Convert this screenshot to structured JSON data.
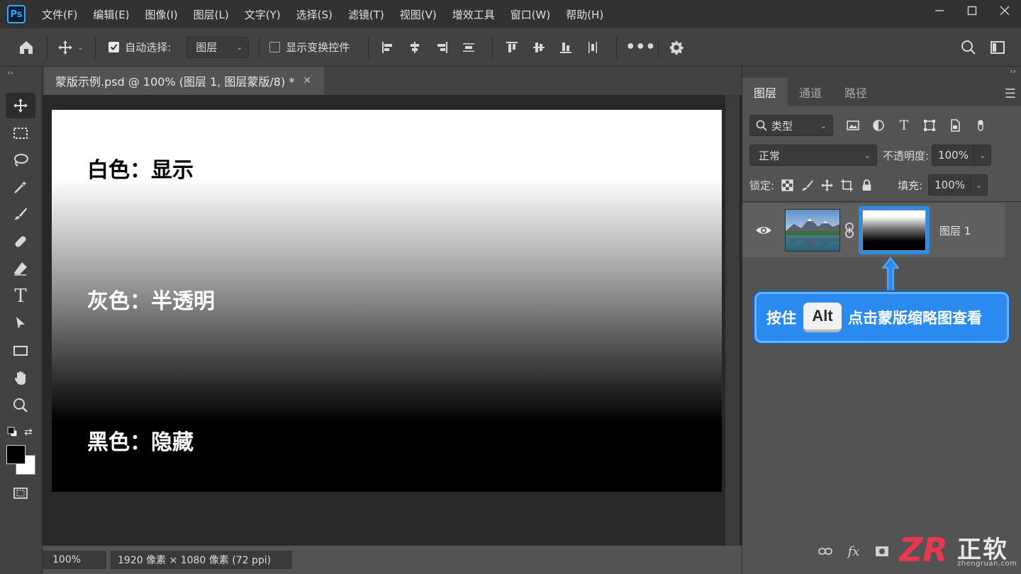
{
  "app": {
    "logo": "Ps",
    "menu": [
      "文件(F)",
      "编辑(E)",
      "图像(I)",
      "图层(L)",
      "文字(Y)",
      "选择(S)",
      "滤镜(T)",
      "视图(V)",
      "增效工具",
      "窗口(W)",
      "帮助(H)"
    ],
    "window_controls": [
      "minimize-icon",
      "maximize-icon",
      "close-icon"
    ]
  },
  "options_bar": {
    "auto_select_label": "自动选择:",
    "auto_select_checked": true,
    "auto_select_target": "图层",
    "show_transform_label": "显示变换控件",
    "show_transform_checked": false
  },
  "document": {
    "tab_title": "蒙版示例.psd @ 100% (图层 1, 图层蒙版/8) *",
    "canvas_text": {
      "white": "白色：显示",
      "gray": "灰色：半透明",
      "black": "黑色：隐藏"
    },
    "zoom": "100%",
    "info": "1920 像素 × 1080 像素 (72 ppi)"
  },
  "layers_panel": {
    "tabs": [
      "图层",
      "通道",
      "路径"
    ],
    "active_tab": "图层",
    "filter_kind": "类型",
    "blend_mode": "正常",
    "opacity_label": "不透明度:",
    "opacity_value": "100%",
    "lock_label": "锁定:",
    "fill_label": "填充:",
    "fill_value": "100%",
    "layer": {
      "name": "图层 1",
      "visible": true
    }
  },
  "callout": {
    "prefix": "按住",
    "key": "Alt",
    "suffix": "点击蒙版缩略图查看"
  },
  "watermark": {
    "logo": "ZR",
    "text": "正软",
    "url": "zhengruan.com"
  },
  "colors": {
    "accent": "#2a8af0",
    "menubar": "#323232",
    "panel": "#535353",
    "toolbar": "#424242",
    "watermark_red": "#e8384f"
  }
}
